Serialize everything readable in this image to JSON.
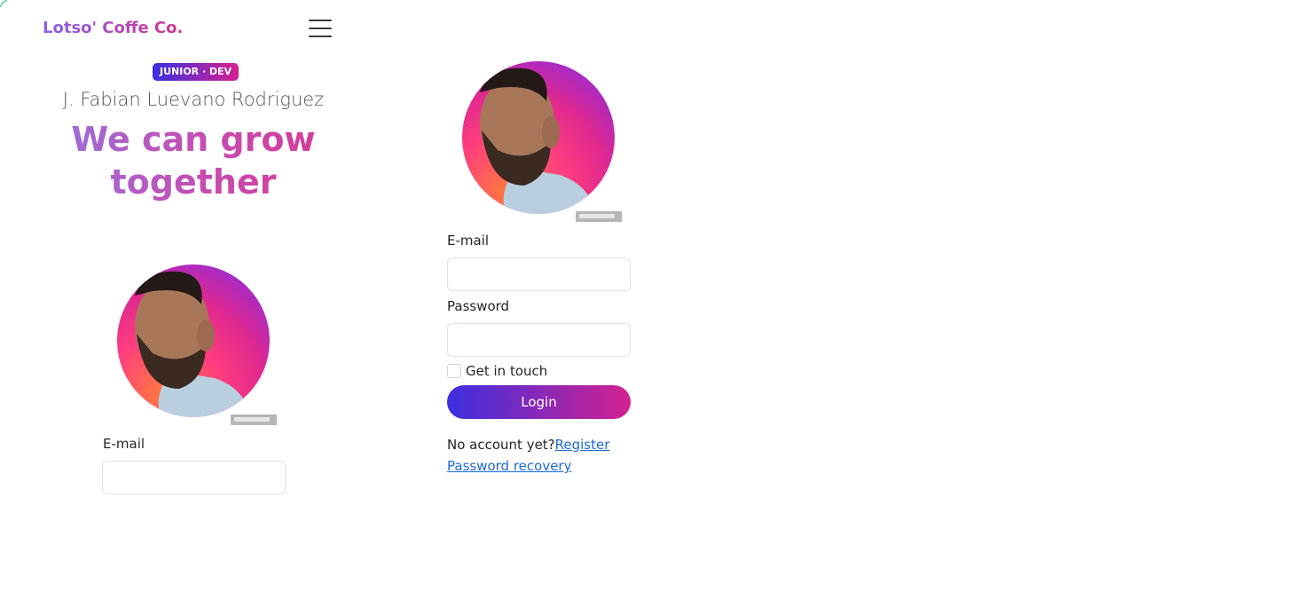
{
  "navbar": {
    "brand": "Lotso' Coffe Co.",
    "menu_icon": "hamburger-menu-icon"
  },
  "hero": {
    "badge": "JUNIOR · DEV",
    "author_name": "J. Fabian Luevano Rodriguez",
    "headline": "We can grow together"
  },
  "left_form": {
    "email_label": "E-mail",
    "email_value": "",
    "email_placeholder": ""
  },
  "login_form": {
    "email_label": "E-mail",
    "email_value": "",
    "password_label": "Password",
    "password_value": "",
    "remember_label": "Get in touch",
    "remember_checked": false,
    "login_button": "Login",
    "no_account_text": "No account yet?",
    "register_link": "Register",
    "recovery_link": "Password recovery"
  },
  "colors": {
    "accent_start": "#3c2fe0",
    "accent_end": "#d42190",
    "link": "#1a6ad6"
  }
}
